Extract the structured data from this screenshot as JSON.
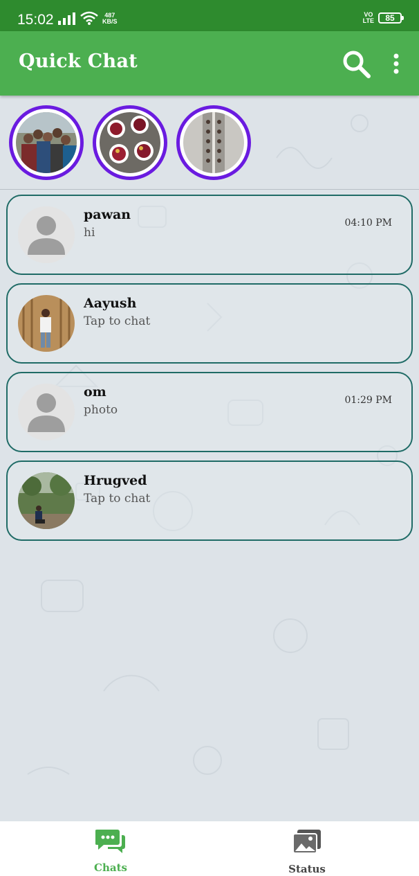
{
  "status_bar": {
    "time": "15:02",
    "net_speed_value": "487",
    "net_speed_unit": "KB/S",
    "volte_top": "VO",
    "volte_bottom": "LTE",
    "battery": "85"
  },
  "app_bar": {
    "title": "Quick Chat",
    "search_icon": "search-icon",
    "menu_icon": "more-vert-icon"
  },
  "stories": [
    {
      "name": "story-1",
      "ring_color": "#6a1be0"
    },
    {
      "name": "story-2",
      "ring_color": "#6a1be0"
    },
    {
      "name": "story-3",
      "ring_color": "#6a1be0"
    }
  ],
  "chats": [
    {
      "name": "pawan",
      "message": "hi",
      "time": "04:10 PM"
    },
    {
      "name": "Aayush",
      "message": "Tap to chat",
      "time": ""
    },
    {
      "name": "om",
      "message": "photo",
      "time": "01:29 PM"
    },
    {
      "name": "Hrugved",
      "message": "Tap to chat",
      "time": ""
    }
  ],
  "bottom_nav": {
    "chats_label": "Chats",
    "status_label": "Status",
    "active_color": "#4caf50",
    "inactive_color": "#444444"
  },
  "colors": {
    "status_bar": "#2e8b2e",
    "app_bar": "#4caf50",
    "story_ring": "#6a1be0",
    "chat_border": "#1f6b66"
  }
}
